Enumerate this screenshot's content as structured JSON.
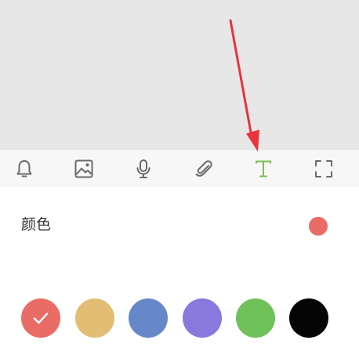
{
  "colors": {
    "background_top": "#e7e7e7",
    "toolbar_bg": "#f7f7f7",
    "icon_gray": "#6a6a6a",
    "icon_active": "#7cbd52",
    "annotation_red": "#e8343a"
  },
  "toolbar": {
    "items": [
      {
        "icon": "bell-icon",
        "active": false
      },
      {
        "icon": "image-icon",
        "active": false
      },
      {
        "icon": "microphone-icon",
        "active": false
      },
      {
        "icon": "paperclip-icon",
        "active": false
      },
      {
        "icon": "text-icon",
        "active": true
      },
      {
        "icon": "fullscreen-icon",
        "active": false
      }
    ]
  },
  "color_setting": {
    "label": "颜色",
    "current_color": "#ea6c67"
  },
  "palette": {
    "swatches": [
      {
        "color": "#ea6c67",
        "selected": true
      },
      {
        "color": "#e2bd74",
        "selected": false
      },
      {
        "color": "#6688c8",
        "selected": false
      },
      {
        "color": "#8978de",
        "selected": false
      },
      {
        "color": "#6fc25a",
        "selected": false
      },
      {
        "color": "#050505",
        "selected": false
      }
    ]
  }
}
